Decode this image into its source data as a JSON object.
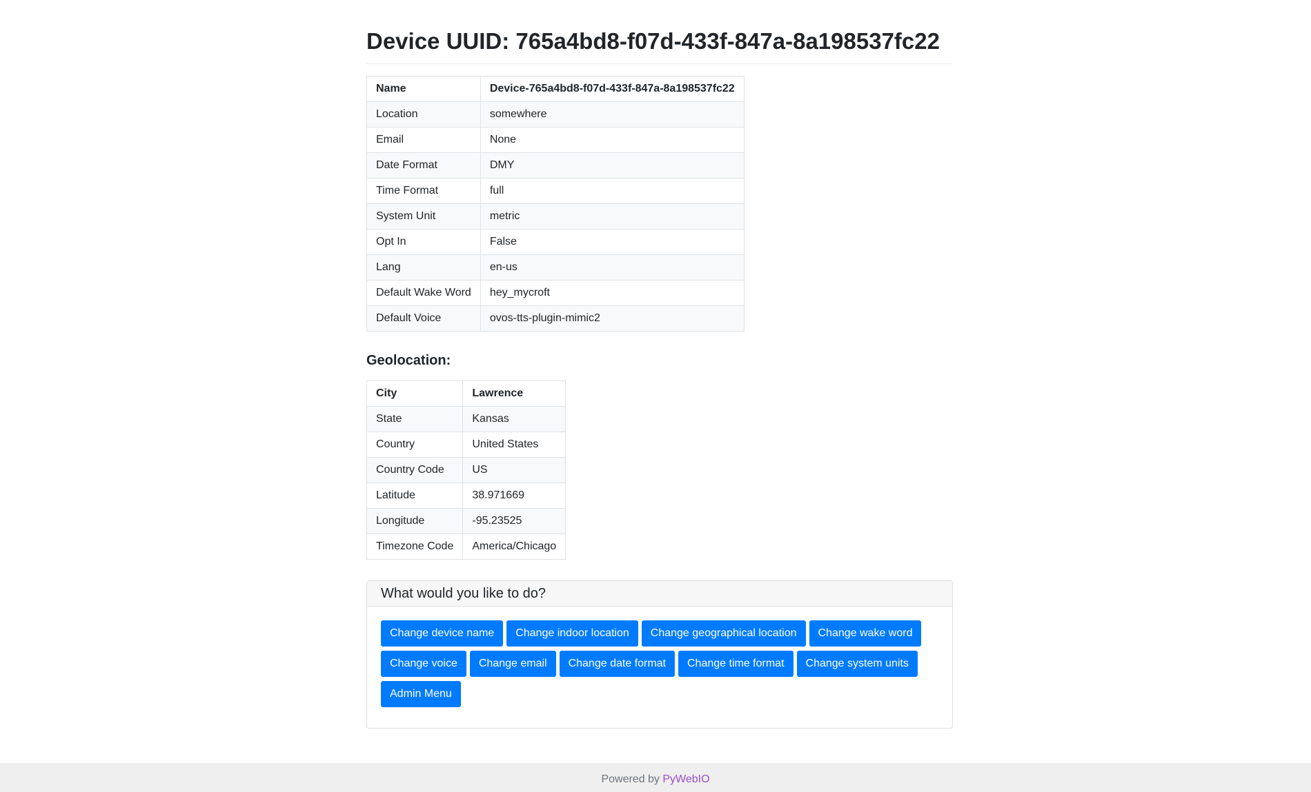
{
  "header": {
    "title": "Device UUID: 765a4bd8-f07d-433f-847a-8a198537fc22"
  },
  "device_table": {
    "rows": [
      [
        "Name",
        "Device-765a4bd8-f07d-433f-847a-8a198537fc22"
      ],
      [
        "Location",
        "somewhere"
      ],
      [
        "Email",
        "None"
      ],
      [
        "Date Format",
        "DMY"
      ],
      [
        "Time Format",
        "full"
      ],
      [
        "System Unit",
        "metric"
      ],
      [
        "Opt In",
        "False"
      ],
      [
        "Lang",
        "en-us"
      ],
      [
        "Default Wake Word",
        "hey_mycroft"
      ],
      [
        "Default Voice",
        "ovos-tts-plugin-mimic2"
      ]
    ]
  },
  "geolocation": {
    "heading": "Geolocation:",
    "rows": [
      [
        "City",
        "Lawrence"
      ],
      [
        "State",
        "Kansas"
      ],
      [
        "Country",
        "United States"
      ],
      [
        "Country Code",
        "US"
      ],
      [
        "Latitude",
        "38.971669"
      ],
      [
        "Longitude",
        "-95.23525"
      ],
      [
        "Timezone Code",
        "America/Chicago"
      ]
    ]
  },
  "actions": {
    "heading": "What would you like to do?",
    "buttons": [
      "Change device name",
      "Change indoor location",
      "Change geographical location",
      "Change wake word",
      "Change voice",
      "Change email",
      "Change date format",
      "Change time format",
      "Change system units",
      "Admin Menu"
    ]
  },
  "footer": {
    "prefix": "Powered by ",
    "link": "PyWebIO"
  },
  "colors": {
    "button_bg": "#007bff",
    "footer_link": "#9b4dca"
  }
}
